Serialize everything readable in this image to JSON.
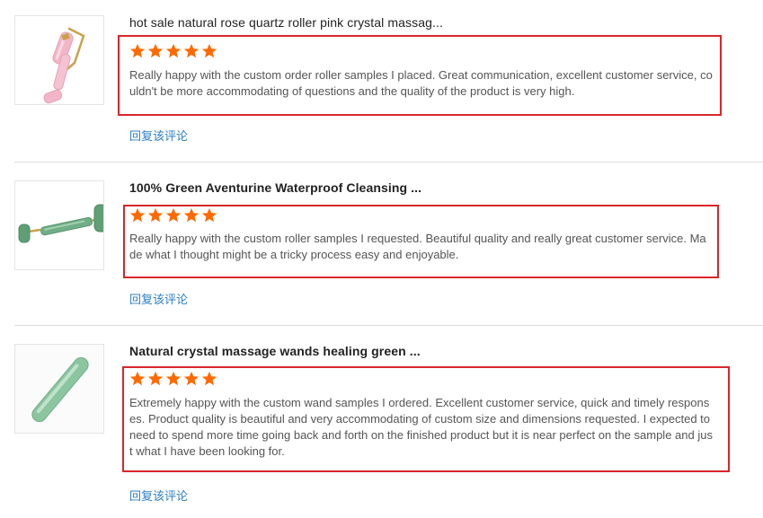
{
  "colors": {
    "star": "#ff6a00",
    "highlight_border": "#d9262b",
    "reply_link": "#2e7fc7",
    "body_text": "#555555",
    "title_text": "#222222"
  },
  "reviews": [
    {
      "product_image": "rose-quartz-roller-image",
      "title": "hot sale natural rose quartz roller pink crystal massag...",
      "rating": 5,
      "rating_max": 5,
      "text": "Really happy with the custom order roller samples I placed. Great communication, excellent customer service, couldn't be more accommodating of questions and the quality of the product is very high.",
      "reply_label": "回复该评论"
    },
    {
      "product_image": "green-aventurine-roller-image",
      "title": "100% Green Aventurine Waterproof Cleansing ...",
      "rating": 5,
      "rating_max": 5,
      "text": "Really happy with the custom roller samples I requested. Beautiful quality and really great customer service. Made what I thought might be a tricky process easy and enjoyable.",
      "reply_label": "回复该评论"
    },
    {
      "product_image": "green-crystal-wand-image",
      "title": "Natural crystal massage wands healing green ...",
      "rating": 5,
      "rating_max": 5,
      "text": "Extremely happy with the custom wand samples I ordered. Excellent customer service, quick and timely responses. Product quality is beautiful and very accommodating of custom size and dimensions requested. I expected to need to spend more time going back and forth on the finished product but it is near perfect on the sample and just what I have been looking for.",
      "reply_label": "回复该评论"
    }
  ]
}
